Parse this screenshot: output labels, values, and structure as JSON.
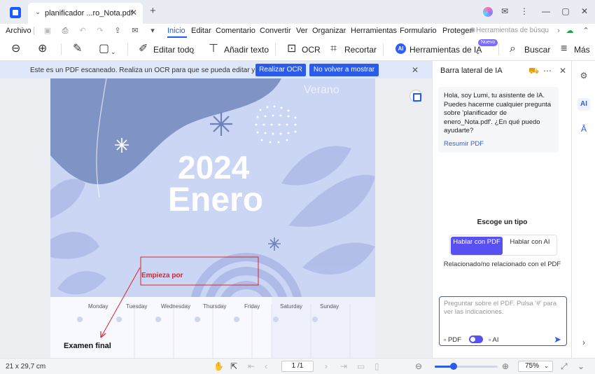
{
  "titlebar": {
    "tab_title": "planificador ...ro_Nota.pdf",
    "tab_close": "✕",
    "tab_add": "+",
    "window_controls": [
      "✉",
      "⋮",
      "—",
      "▢",
      "✕"
    ]
  },
  "menubar": {
    "items": [
      "Archivo",
      "Inicio",
      "Editar",
      "Comentario",
      "Convertir",
      "Ver",
      "Organizar",
      "Herramientas",
      "Formulario",
      "Proteger"
    ],
    "active": "Inicio",
    "search_placeholder": "Herramientas de búsqu"
  },
  "toolbar": {
    "edit_all": "Editar todo",
    "add_text": "Añadir texto",
    "ocr": "OCR",
    "crop": "Recortar",
    "ai_tools": "Herramientas de IA",
    "new_badge": "Nuevo",
    "search": "Buscar",
    "more": "Más"
  },
  "notice": {
    "text": "Este es un PDF escaneado. Realiza un OCR para que se pueda editar y buscar.",
    "ocr_button": "Realizar OCR",
    "dismiss_button": "No volver a mostrar"
  },
  "document": {
    "season": "Verano",
    "year": "2024",
    "month": "Enero",
    "annotation": "Empieza por",
    "weekdays": [
      "Monday",
      "Tuesday",
      "Wednesday",
      "Thursday",
      "Friday",
      "Saturday",
      "Sunday"
    ],
    "note": "Examen final"
  },
  "aipanel": {
    "title": "Barra lateral de IA",
    "greeting": "Hola, soy Lumi, tu asistente de IA. Puedes hacerme cualquier pregunta sobre 'planificador de enero_Nota.pdf'. ¿En qué puedo ayudarte?",
    "summarize_link": "Resumir PDF",
    "choose_title": "Escoge un tipo",
    "mode_pdf": "Hablar con PDF",
    "mode_ai": "Hablar con AI",
    "relation_text": "Relacionado/no relacionado con el PDF",
    "ask_placeholder": "Preguntar sobre el PDF. Pulsa '#' para ver las indicaciones.",
    "ask_pdf_label": "PDF",
    "ask_ai_label": "AI"
  },
  "statusbar": {
    "page_size": "21 x 29,7 cm",
    "page_indicator": "1 /1",
    "zoom": "75%",
    "zoom_fraction": 0.3
  }
}
